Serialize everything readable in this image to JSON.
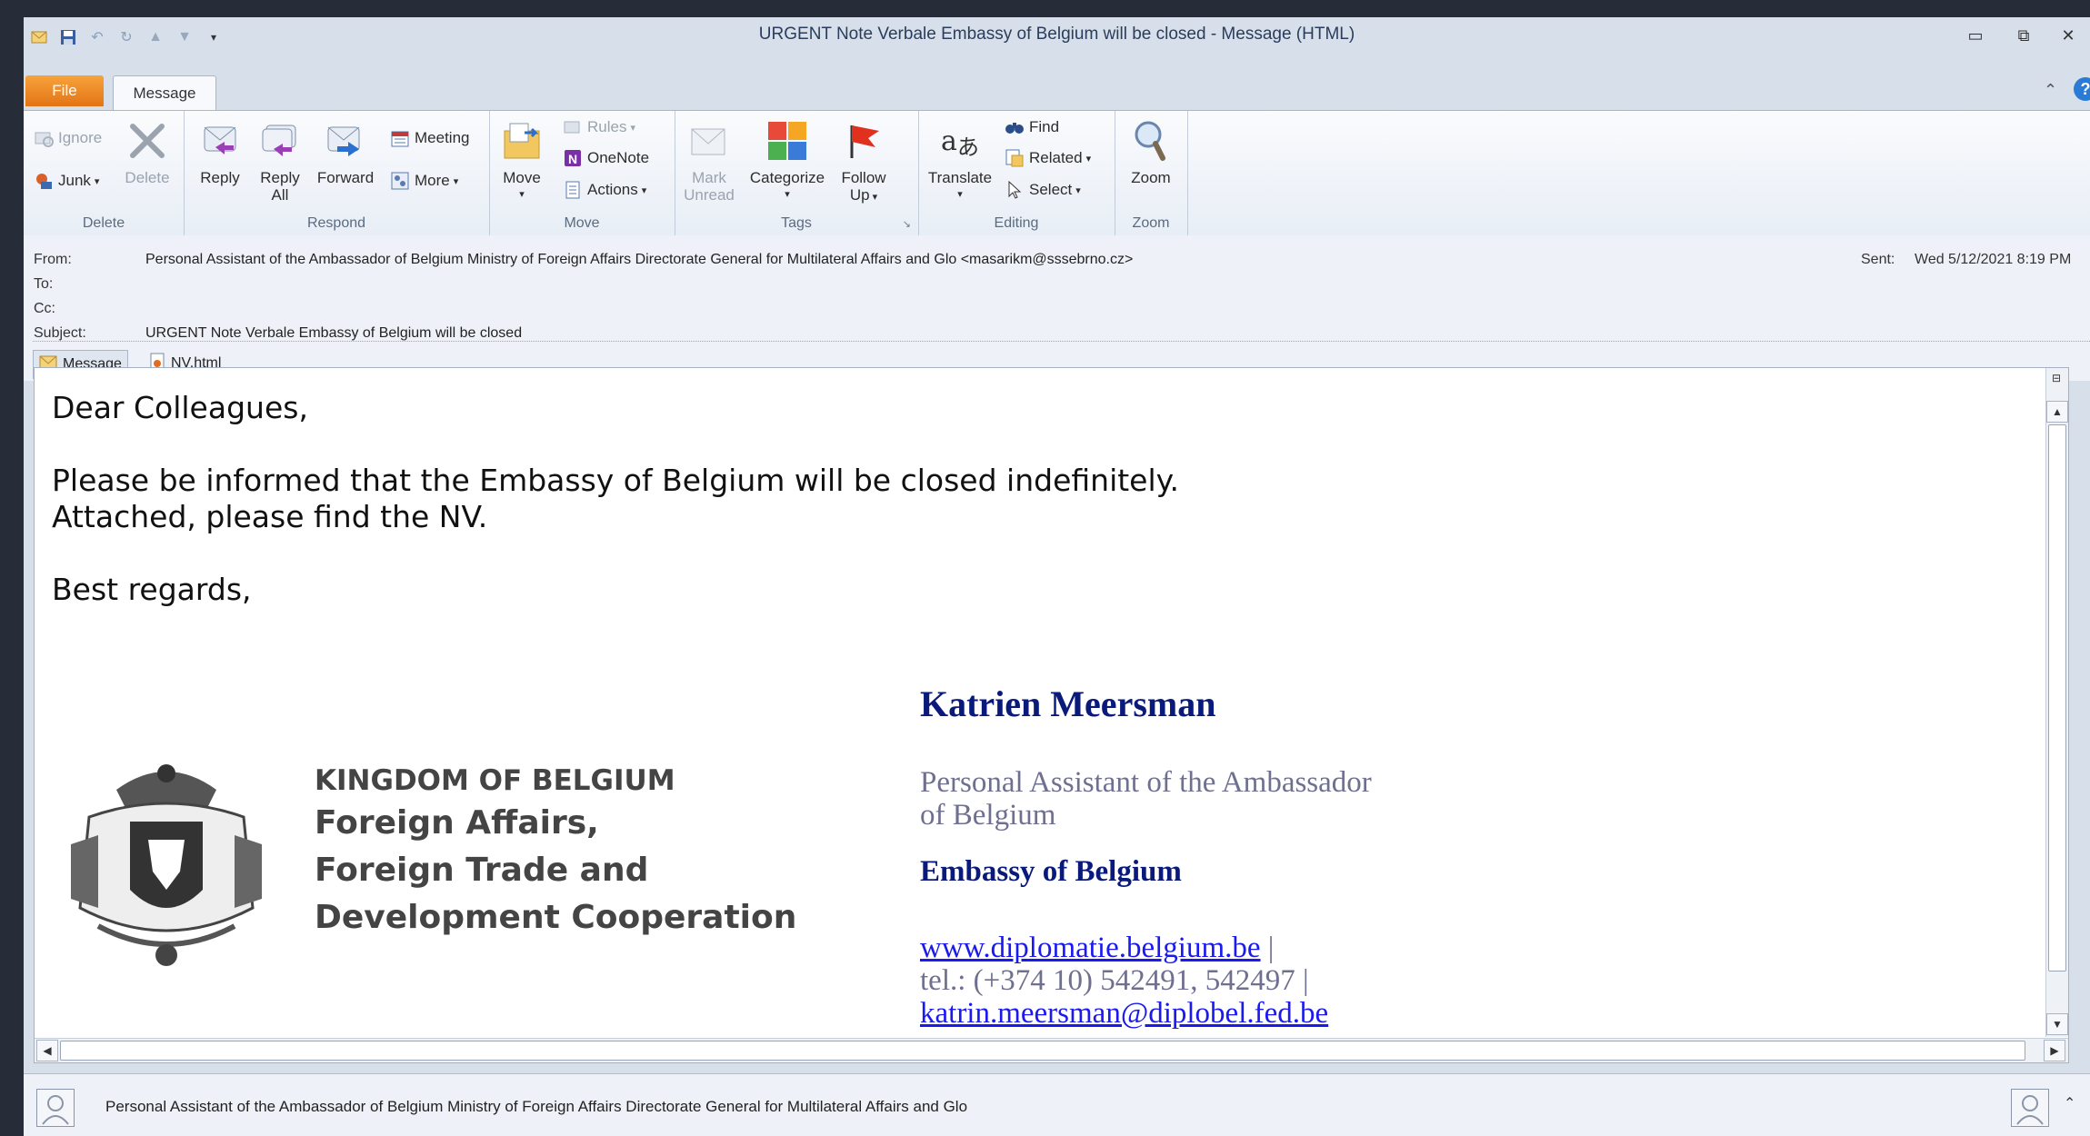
{
  "window": {
    "title": "URGENT Note Verbale Embassy of Belgium will be closed  -  Message (HTML)"
  },
  "tabs": {
    "file": "File",
    "message": "Message"
  },
  "ribbon": {
    "delete_group": {
      "label": "Delete",
      "ignore": "Ignore",
      "junk": "Junk",
      "delete": "Delete"
    },
    "respond_group": {
      "label": "Respond",
      "reply": "Reply",
      "reply_all_1": "Reply",
      "reply_all_2": "All",
      "forward": "Forward",
      "meeting": "Meeting",
      "more": "More"
    },
    "move_group": {
      "label": "Move",
      "move": "Move",
      "rules": "Rules",
      "onenote": "OneNote",
      "actions": "Actions"
    },
    "tags_group": {
      "label": "Tags",
      "mark_unread_1": "Mark",
      "mark_unread_2": "Unread",
      "categorize": "Categorize",
      "follow_up_1": "Follow",
      "follow_up_2": "Up"
    },
    "editing_group": {
      "label": "Editing",
      "translate": "Translate",
      "find": "Find",
      "related": "Related",
      "select": "Select"
    },
    "zoom_group": {
      "label": "Zoom",
      "zoom": "Zoom"
    }
  },
  "header": {
    "from_label": "From:",
    "from_value": "Personal Assistant of the Ambassador of Belgium Ministry of Foreign Affairs Directorate General for Multilateral Affairs and Glo <masarikm@sssebrno.cz>",
    "to_label": "To:",
    "cc_label": "Cc:",
    "subject_label": "Subject:",
    "subject_value": "URGENT Note Verbale Embassy of Belgium will be closed",
    "sent_label": "Sent:",
    "sent_value": "Wed 5/12/2021 8:19 PM"
  },
  "attachments": {
    "message_tab": "Message",
    "file": "NV.html"
  },
  "body": {
    "greeting": "Dear Colleagues,",
    "line1": "Please be informed that the Embassy of Belgium will be closed indefinitely.",
    "line2": "Attached, please find the NV.",
    "closing": "Best regards,"
  },
  "signature": {
    "logo_line1": "KINGDOM OF BELGIUM",
    "logo_line2": "Foreign Affairs,",
    "logo_line3": "Foreign Trade and",
    "logo_line4": "Development Cooperation",
    "name": "Katrien Meersman",
    "role_1": "Personal Assistant of the Ambassador",
    "role_2": "of Belgium",
    "org": "Embassy of Belgium",
    "website": "www.diplomatie.belgium.be",
    "pipe": " |",
    "tel": "tel.: (+374 10) 542491, 542497 |",
    "email": "katrin.meersman@diplobel.fed.be"
  },
  "people_pane": {
    "sender": "Personal Assistant of the Ambassador of Belgium Ministry of Foreign Affairs Directorate General for Multilateral Affairs and Glo"
  },
  "colors": {
    "title_bg": "#d7dfea",
    "file_tab": "#e37416",
    "link": "#1a1aee",
    "signature_navy": "#0a1a7a",
    "signature_grey": "#6f6f8f"
  }
}
